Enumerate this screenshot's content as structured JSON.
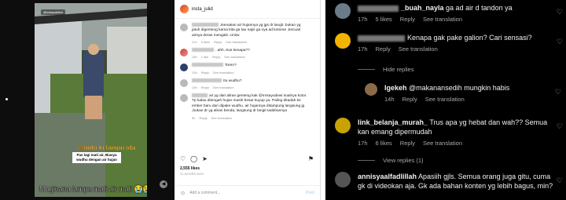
{
  "video": {
    "watermark": "@instapahlevi",
    "overlay_top": "@mdo ki lampu ida keckrisia!",
    "overlay_box": "Pas lagi mati air, Biasya wudhu dengan air hujan",
    "caption": "Moginana lampu mati air mati 😭😭"
  },
  "post": {
    "username": "insta_julid",
    "likes": "2,555 likes",
    "time_ago": "11 HOURS AGO",
    "add_comment_placeholder": "Add a comment...",
    "post_label": "Post",
    "comments": [
      {
        "text": "Jsenakan air hujannya yg jgs dr langit .bukan yg jatuh digenteng kama kita ga tau najis ga nya ad kotoran ,kecuali airnya deras mengalir..cmiiw",
        "meta": [
          "21h",
          "5 likes",
          "Reply",
          "See translation"
        ],
        "avatar": "gray"
      },
      {
        "text": "..ahh..trus kenapa??",
        "meta": [
          "19h",
          "1 like",
          "Reply",
          "See translation"
        ],
        "avatar": "color"
      },
      {
        "text": "Toren?",
        "meta": [
          "13h",
          "Reply",
          "See translation"
        ],
        "avatar": "dark"
      },
      {
        "text": "Itu wudhu?",
        "meta": [
          "13h",
          "Reply",
          "See translation"
        ],
        "avatar": "gray"
      },
      {
        "text": "air yg dari aliran genteng kak @mrsayudewi soalnya kotor. Tp kalau ditengah hujan masih besar kuyup ya. Paling ditadah ke ember baru dari dipake wudhu. air hujannya ditampung langsung jg ,bukan dr yg aliran benda, langsung dr langit tadahannya",
        "meta": [
          "9h",
          "Reply",
          "See translation"
        ],
        "avatar": "gray"
      }
    ]
  },
  "right_comments": [
    {
      "user": "_buah_nayla",
      "text": "ga ad air d tandon ya",
      "meta": [
        "17h",
        "5 likes",
        "Reply",
        "See translation"
      ],
      "avatar_color": "#6b7c88"
    },
    {
      "user": "",
      "text": "Kenapa gak pake galion? Cari sensasi?",
      "meta": [
        "17h",
        "Reply",
        "See translation"
      ],
      "avatar_color": "#f2b300"
    },
    {
      "user": "lgekeh",
      "text": "@makanansedih mungkin habis",
      "meta": [
        "14h",
        "Reply",
        "See translation"
      ],
      "avatar_color": "#8b6a4a"
    },
    {
      "user": "link_belanja_murah_",
      "text": "Trus apa yg hebat dan wah?? Semua kan emang dipermudah",
      "meta": [
        "17h",
        "6 likes",
        "Reply",
        "See translation"
      ],
      "avatar_color": "#c8a200"
    },
    {
      "user": "annisyaalfadlillah",
      "text": "Apasiih gjls. Semua orang juga gitu, cuma gk di videokan aja. Gk ada bahan konten yg lebih bagus, min?",
      "meta": [],
      "avatar_color": "#555"
    }
  ],
  "hide_replies": "Hide replies",
  "view_replies": "View replies (1)",
  "icons": [
    "heart-icon",
    "comment-icon",
    "share-icon",
    "bookmark-icon",
    "emoji-icon"
  ]
}
